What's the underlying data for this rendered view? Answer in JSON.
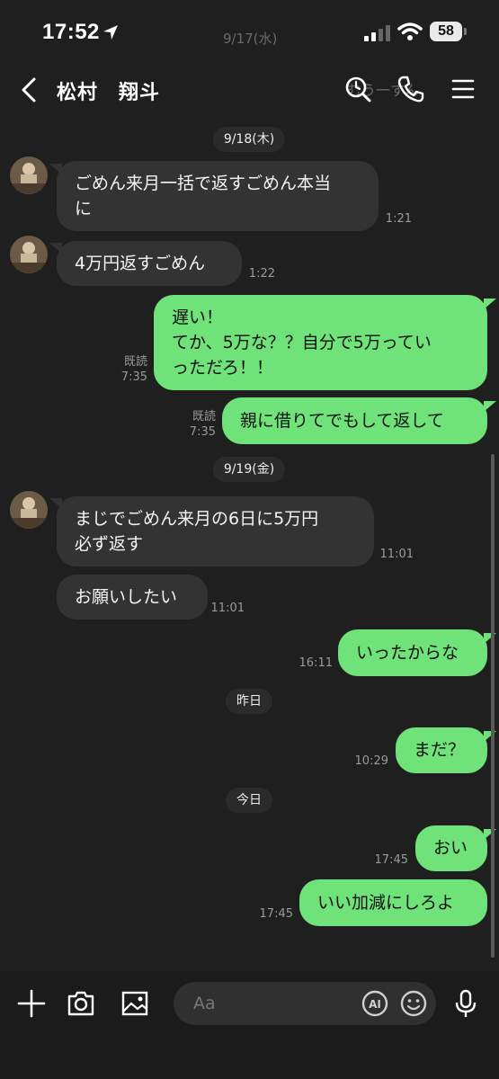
{
  "status": {
    "time": "17:52",
    "battery": "58"
  },
  "ghost": {
    "date_text": "9/17(水)",
    "message_text": "むう一すん"
  },
  "header": {
    "title": "松村　翔斗"
  },
  "dates": {
    "d1": "9/18(木)",
    "d2": "9/19(金)",
    "d3": "昨日",
    "d4": "今日"
  },
  "messages": [
    {
      "text": "ごめん来月一括で返すごめん本当\nに",
      "time": "1:21"
    },
    {
      "text": "4万円返すごめん",
      "time": "1:22"
    },
    {
      "text": "遅い！\nてか、5万な？？自分で5万ってい\nっただろ！！",
      "read": "既読",
      "time": "7:35"
    },
    {
      "text": "親に借りてでもして返して",
      "read": "既読",
      "time": "7:35"
    },
    {
      "text": "まじでごめん来月の6日に5万円\n必ず返す",
      "time": "11:01"
    },
    {
      "text": "お願いしたい",
      "time": "11:01"
    },
    {
      "text": "いったからな",
      "time": "16:11"
    },
    {
      "text": "まだ？",
      "time": "10:29"
    },
    {
      "text": "おい",
      "time": "17:45"
    },
    {
      "text": "いい加減にしろよ",
      "time": "17:45"
    }
  ],
  "input": {
    "placeholder": "Aa"
  }
}
